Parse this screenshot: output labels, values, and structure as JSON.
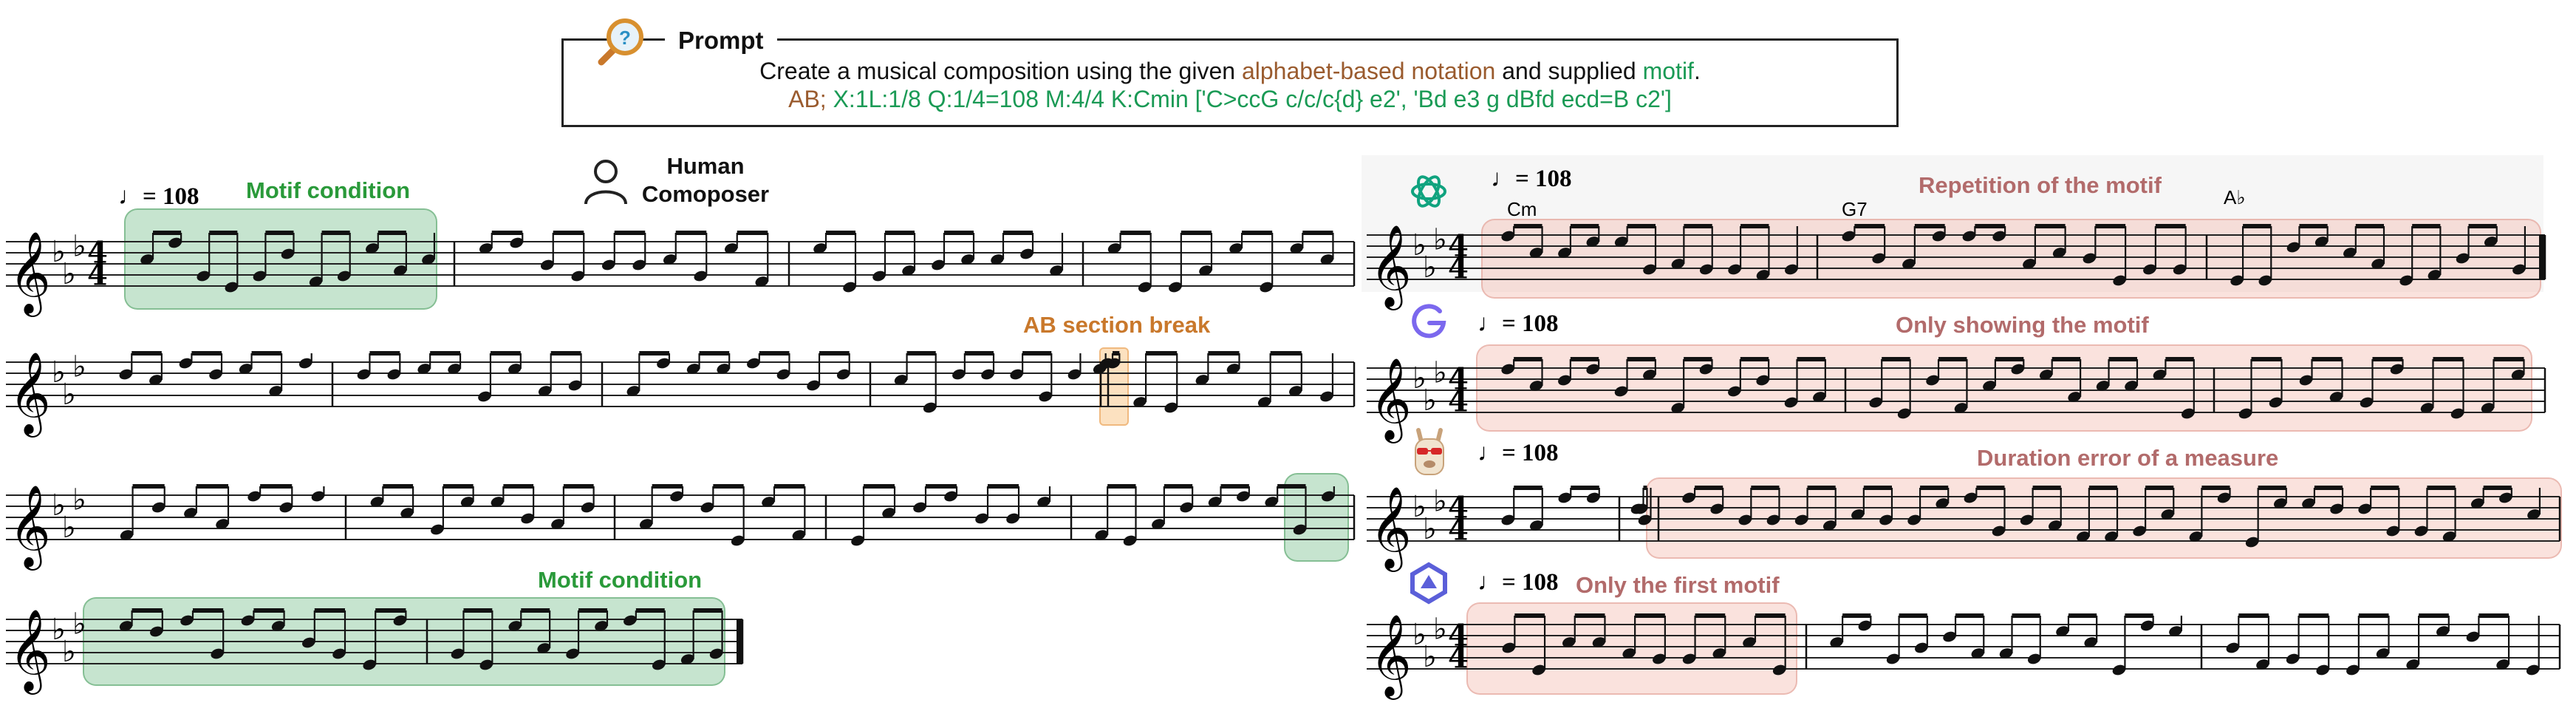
{
  "prompt": {
    "title": "Prompt",
    "line1_pre": "Create a musical composition using the given ",
    "line1_notation": "alphabet-based notation",
    "line1_mid": " and supplied ",
    "line1_motif": "motif",
    "line1_end": ".",
    "line2_ab": "AB",
    "line2_sep": "; ",
    "line2_code": "X:1L:1/8 Q:1/4=108 M:4/4 K:Cmin ['C>ccG c/c/c{d} e2', 'Bd e3 g dBfd ecd=B c2']"
  },
  "human": {
    "label_line1": "Human",
    "label_line2": "Comoposer"
  },
  "tempo_text": "= 108",
  "labels": {
    "motif_condition": "Motif condition",
    "ab_section_break": "AB section break",
    "repetition": "Repetition of the motif",
    "only_showing": "Only showing the motif",
    "duration_error": "Duration error of a measure",
    "only_first": "Only the first motif"
  },
  "chords": {
    "c1": "Cm",
    "c2": "G7",
    "c3": "A♭"
  },
  "colors": {
    "green": "#1a9a55",
    "brown": "#9a5b2e",
    "rose": "#b26b6b",
    "orange": "#c9782b"
  },
  "icons": [
    "magnifier-icon",
    "person-icon",
    "openai-icon",
    "gemini-icon",
    "llama-icon",
    "claude-icon"
  ]
}
